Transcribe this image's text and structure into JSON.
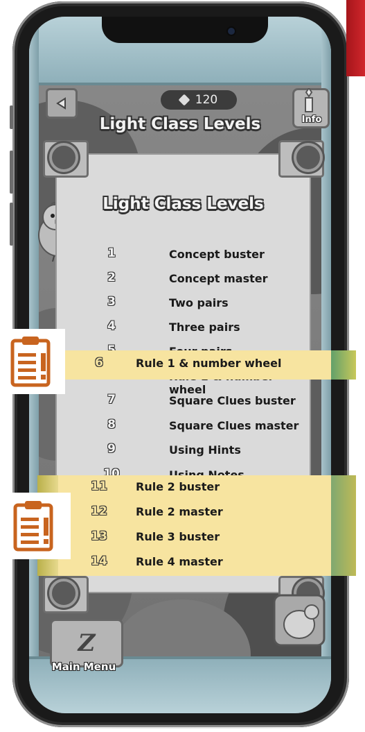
{
  "header": {
    "back_icon": "back-triangle-icon",
    "gems": {
      "icon": "gem-icon",
      "count": "120"
    },
    "title": "Light Class Levels",
    "info_label": "Info"
  },
  "panel": {
    "title": "Light Class Levels",
    "levels": [
      {
        "num": "1",
        "name": "Concept buster"
      },
      {
        "num": "2",
        "name": "Concept master"
      },
      {
        "num": "3",
        "name": "Two pairs"
      },
      {
        "num": "4",
        "name": "Three pairs"
      },
      {
        "num": "5",
        "name": "Four pairs"
      },
      {
        "num": "6",
        "name": "Rule 1 & number wheel"
      },
      {
        "num": "7",
        "name": "Square Clues buster"
      },
      {
        "num": "8",
        "name": "Square Clues master"
      },
      {
        "num": "9",
        "name": "Using Hints"
      },
      {
        "num": "10",
        "name": "Using Notes"
      },
      {
        "num": "11",
        "name": "Rule 2 buster"
      },
      {
        "num": "12",
        "name": "Rule 2 master"
      },
      {
        "num": "13",
        "name": "Rule 3 buster"
      },
      {
        "num": "14",
        "name": "Rule 4 master"
      }
    ]
  },
  "highlights": {
    "single": [
      {
        "num": "6",
        "name": "Rule 1 & number wheel"
      }
    ],
    "group": [
      {
        "num": "11",
        "name": "Rule 2 buster"
      },
      {
        "num": "12",
        "name": "Rule 2 master"
      },
      {
        "num": "13",
        "name": "Rule 3 buster"
      },
      {
        "num": "14",
        "name": "Rule 4 master"
      }
    ],
    "icon": "clipboard-alert-icon",
    "accent": "#c8641f",
    "fill": "#f7e4a0"
  },
  "footer": {
    "main_menu_logo": "Z",
    "main_menu_label": "Main Menu"
  },
  "colors": {
    "frame": "#a8c3cb",
    "panel": "#dadada",
    "phone": "#1a1a1a"
  }
}
